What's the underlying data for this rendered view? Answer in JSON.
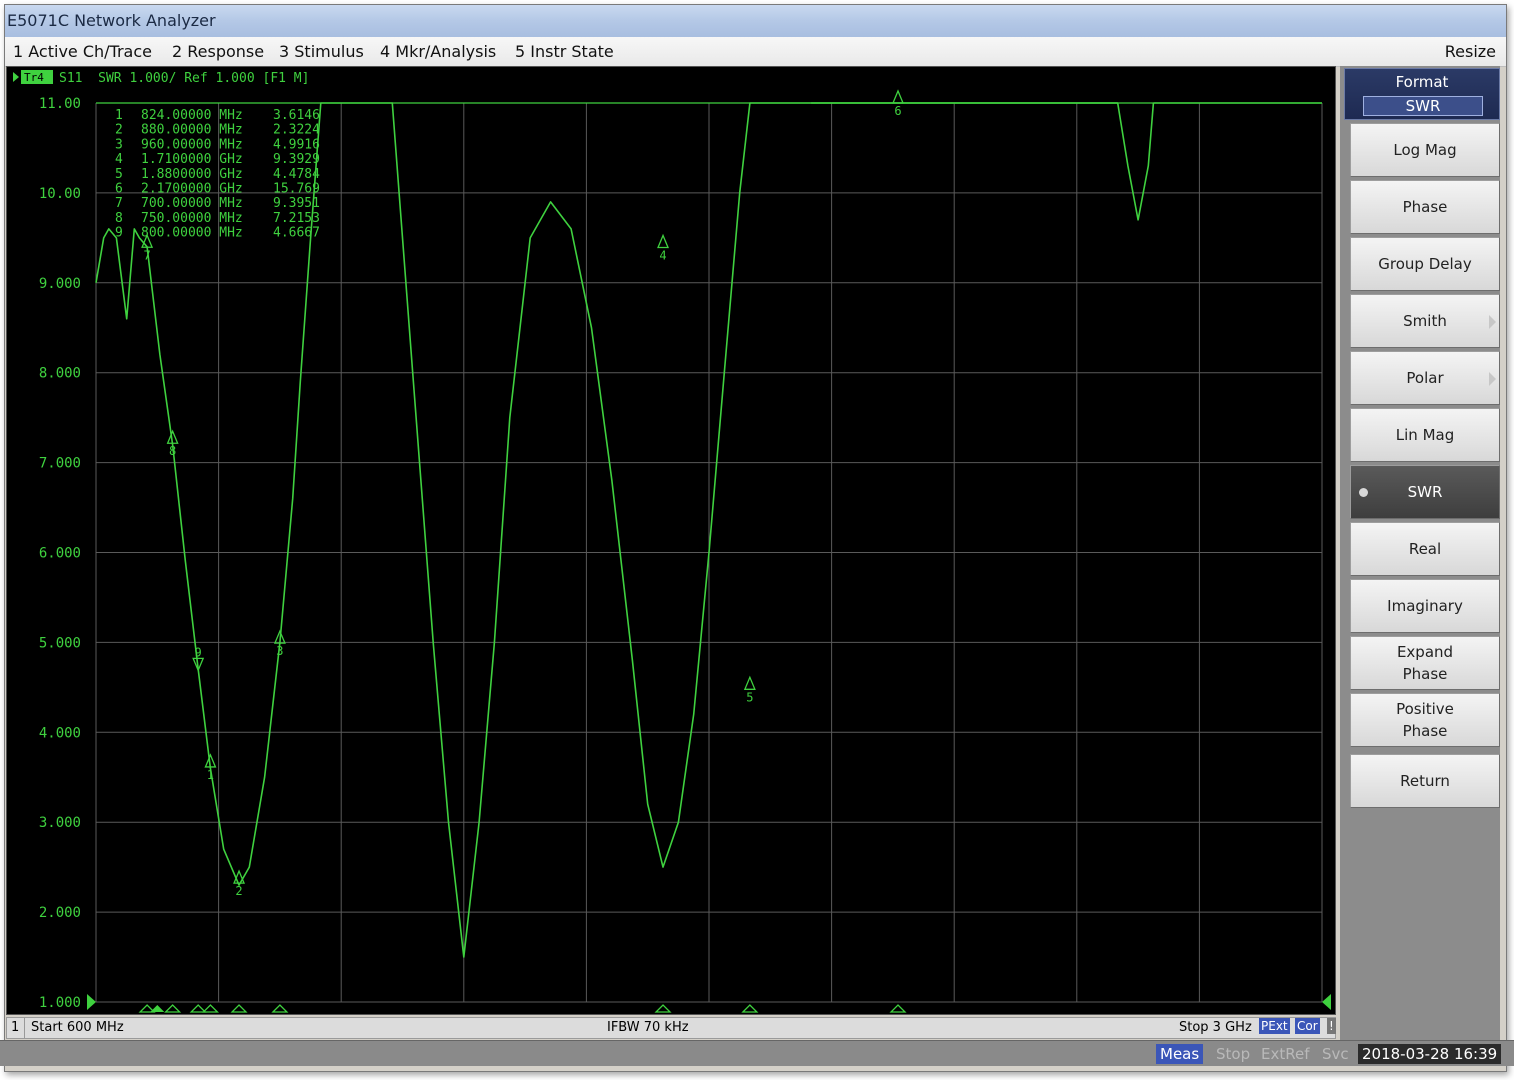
{
  "window": {
    "title": "E5071C Network Analyzer"
  },
  "menu": {
    "items": [
      "1 Active Ch/Trace",
      "2 Response",
      "3 Stimulus",
      "4 Mkr/Analysis",
      "5 Instr State"
    ],
    "resize": "Resize"
  },
  "trace_header": {
    "badge": "Tr4",
    "text": "S11  SWR 1.000/ Ref 1.000 [F1 M]"
  },
  "chart_data": {
    "type": "line",
    "title": "",
    "xlabel": "",
    "ylabel": "",
    "xlim": [
      0.6,
      3.0
    ],
    "x_unit": "GHz",
    "ylim": [
      1.0,
      11.0
    ],
    "yticks": [
      "11.00",
      "10.00",
      "9.000",
      "8.000",
      "7.000",
      "6.000",
      "5.000",
      "4.000",
      "3.000",
      "2.000",
      "1.000"
    ],
    "ytick_values": [
      11,
      10,
      9,
      8,
      7,
      6,
      5,
      4,
      3,
      2,
      1
    ],
    "grid": true,
    "series": [
      {
        "x": [
          0.6,
          0.615,
          0.625,
          0.64,
          0.66,
          0.675,
          0.685,
          0.7,
          0.725,
          0.75,
          0.775,
          0.8,
          0.824,
          0.85,
          0.88,
          0.9,
          0.93,
          0.96,
          0.985,
          1.0,
          1.02,
          1.04,
          1.18,
          1.22,
          1.26,
          1.29,
          1.32,
          1.35,
          1.38,
          1.41,
          1.45,
          1.49,
          1.53,
          1.57,
          1.61,
          1.65,
          1.68,
          1.71,
          1.74,
          1.77,
          1.8,
          1.83,
          1.86,
          1.88,
          1.9,
          1.92,
          1.95,
          2.0,
          2.6,
          2.62,
          2.64,
          2.66,
          2.67
        ],
        "y": [
          9.0,
          9.5,
          9.6,
          9.5,
          8.6,
          9.6,
          9.5,
          9.4,
          8.2,
          7.2,
          5.9,
          4.7,
          3.6,
          2.7,
          2.3,
          2.5,
          3.5,
          5.0,
          6.6,
          7.9,
          9.5,
          11.0,
          11.0,
          8.0,
          5.0,
          3.0,
          1.5,
          3.0,
          5.0,
          7.5,
          9.5,
          9.9,
          9.6,
          8.5,
          6.8,
          4.8,
          3.2,
          2.5,
          3.0,
          4.2,
          6.0,
          8.0,
          10.0,
          11.0,
          11.0,
          11.0,
          11.0,
          11.0,
          11.0,
          10.3,
          9.7,
          10.3,
          11.0
        ]
      }
    ],
    "markers": [
      {
        "id": "1",
        "freq": "824.00000 MHz",
        "value": "3.6146",
        "x": 0.824,
        "y": 3.6146,
        "label_side": "below"
      },
      {
        "id": "2",
        "freq": "880.00000 MHz",
        "value": "2.3224",
        "x": 0.88,
        "y": 2.3224,
        "label_side": "below"
      },
      {
        "id": "3",
        "freq": "960.00000 MHz",
        "value": "4.9916",
        "x": 0.96,
        "y": 4.9916,
        "label_side": "below"
      },
      {
        "id": "4",
        "freq": "1.7100000 GHz",
        "value": "9.3929",
        "x": 1.71,
        "y": 9.3929,
        "label_side": "below"
      },
      {
        "id": "5",
        "freq": "1.8800000 GHz",
        "value": "4.4784",
        "x": 1.88,
        "y": 4.4784,
        "label_side": "below"
      },
      {
        "id": "6",
        "freq": "2.1700000 GHz",
        "value": "15.769",
        "x": 2.17,
        "y": 11.0,
        "label_side": "below"
      },
      {
        "id": "7",
        "freq": "700.00000 MHz",
        "value": "9.3951",
        "x": 0.7,
        "y": 9.3951,
        "label_side": "below"
      },
      {
        "id": "8",
        "freq": "750.00000 MHz",
        "value": "7.2153",
        "x": 0.75,
        "y": 7.2153,
        "label_side": "below"
      },
      {
        "id": "9",
        "freq": "800.00000 MHz",
        "value": "4.6667",
        "x": 0.8,
        "y": 4.6667,
        "label_side": "above"
      }
    ],
    "colors": {
      "trace": "#3fd13f",
      "grid": "#5a5a5a",
      "text": "#3fd13f",
      "background": "#000000"
    }
  },
  "status": {
    "channel": "1",
    "start": "Start 600 MHz",
    "ifbw": "IFBW 70 kHz",
    "stop": "Stop 3 GHz",
    "pext": "PExt",
    "cor": "Cor",
    "excl": "!"
  },
  "softkeys": {
    "title": "Format",
    "value": "SWR",
    "buttons": [
      {
        "label": "Log Mag",
        "active": false,
        "arrow": false
      },
      {
        "label": "Phase",
        "active": false,
        "arrow": false
      },
      {
        "label": "Group Delay",
        "active": false,
        "arrow": false
      },
      {
        "label": "Smith",
        "active": false,
        "arrow": true
      },
      {
        "label": "Polar",
        "active": false,
        "arrow": true
      },
      {
        "label": "Lin Mag",
        "active": false,
        "arrow": false
      },
      {
        "label": "SWR",
        "active": true,
        "arrow": false
      },
      {
        "label": "Real",
        "active": false,
        "arrow": false
      },
      {
        "label": "Imaginary",
        "active": false,
        "arrow": false
      },
      {
        "label": "Expand\nPhase",
        "active": false,
        "arrow": false
      },
      {
        "label": "Positive\nPhase",
        "active": false,
        "arrow": false
      },
      {
        "label": "Return",
        "active": false,
        "arrow": false
      }
    ]
  },
  "bottom_bar": {
    "meas": "Meas",
    "stop": "Stop",
    "extref": "ExtRef",
    "svc": "Svc",
    "datetime": "2018-03-28 16:39"
  }
}
